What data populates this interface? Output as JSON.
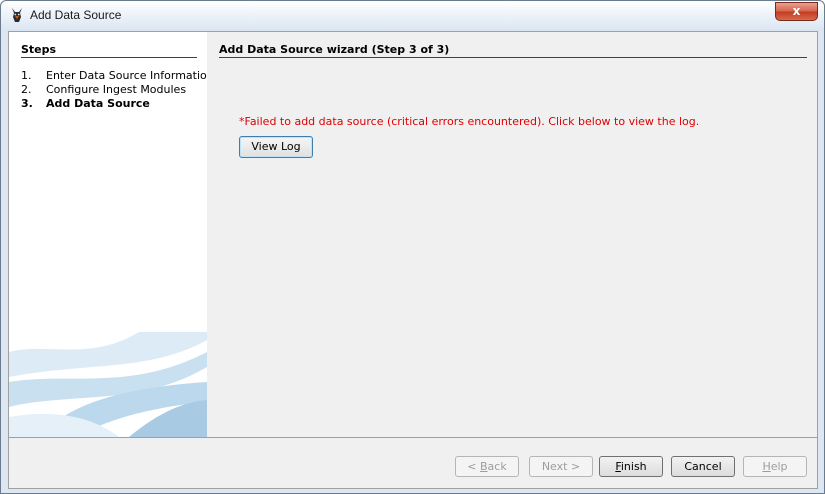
{
  "window": {
    "title": "Add Data Source",
    "close_glyph": "x"
  },
  "steps": {
    "heading": "Steps",
    "items": [
      {
        "num": "1.",
        "label": "Enter Data Source Information",
        "current": false
      },
      {
        "num": "2.",
        "label": "Configure Ingest Modules",
        "current": false
      },
      {
        "num": "3.",
        "label": "Add Data Source",
        "current": true
      }
    ]
  },
  "wizard": {
    "title": "Add Data Source wizard (Step 3 of 3)",
    "error_message": "*Failed to add data source (critical errors encountered). Click below to view the log.",
    "view_log_label": "View Log"
  },
  "buttons": {
    "back": {
      "mnemonic": "B",
      "rest": "ack",
      "prefix": "< ",
      "enabled": false
    },
    "next": {
      "label": "Next >",
      "enabled": false
    },
    "finish": {
      "mnemonic": "F",
      "rest": "inish",
      "enabled": true
    },
    "cancel": {
      "label": "Cancel",
      "enabled": true
    },
    "help": {
      "mnemonic": "H",
      "rest": "elp",
      "enabled": false
    }
  },
  "colors": {
    "error_text": "#e00000",
    "panel_background": "#f0f0f0",
    "titlebar": "#dbe5f1"
  },
  "icons": {
    "app": "autopsy-dog-icon",
    "close": "close-icon"
  }
}
